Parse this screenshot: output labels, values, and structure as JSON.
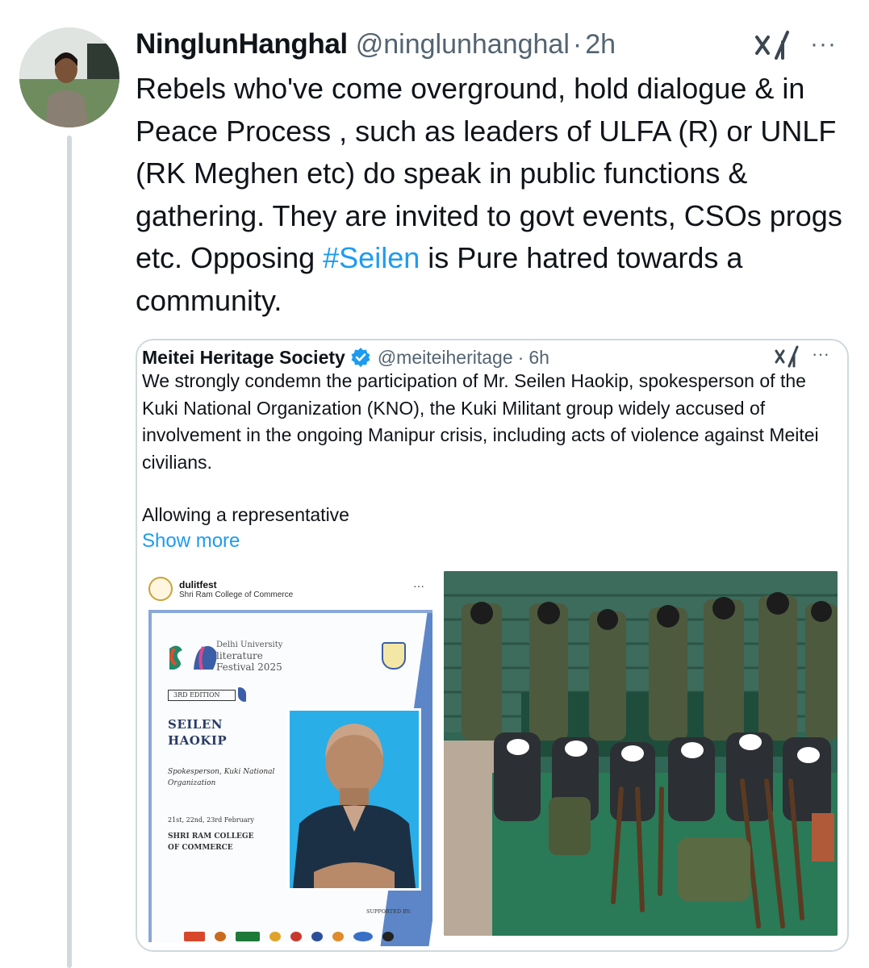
{
  "author": {
    "name": "NinglunHanghal",
    "handle": "@ninglunhanghal",
    "separator": "·",
    "time": "2h",
    "more": "···"
  },
  "tweet": {
    "text_before": "Rebels who've come overground, hold dialogue & in Peace Process , such as leaders of ULFA (R) or UNLF (RK Meghen etc) do speak in public functions & gathering. They are invited to govt events, CSOs progs etc. Opposing ",
    "hashtag": "#Seilen",
    "text_after": " is Pure hatred towards a community."
  },
  "quote": {
    "name": "Meitei Heritage Society",
    "handle": "@meiteiheritage",
    "separator": "·",
    "time": "6h",
    "more": "···",
    "text": "We strongly condemn the participation of Mr. Seilen Haokip, spokesperson of the Kuki National Organization (KNO), the Kuki Militant group widely accused of involvement in the ongoing Manipur crisis, including acts of violence against Meitei civilians.",
    "text2": "Allowing a representative",
    "show_more": "Show more"
  },
  "poster": {
    "account": "dulitfest",
    "subtitle": "Shri Ram College of Commerce",
    "more": "···",
    "fest_line1": "Delhi University",
    "fest_line2": "literature",
    "fest_line3": "Festival 2025",
    "edition": "3RD EDITION",
    "speaker_line1": "SEILEN",
    "speaker_line2": "HAOKIP",
    "role": "Spokesperson, Kuki National Organization",
    "dates": "21st, 22nd, 23rd February",
    "venue_line1": "SHRI RAM COLLEGE",
    "venue_line2": "OF COMMERCE",
    "supported_by": "SUPPORTED BY:"
  },
  "colors": {
    "link": "#1d9bf0",
    "secondary": "#536471",
    "border": "#cfd9de",
    "poster_accent": "#5d86c8"
  },
  "icons": {
    "xai": "xai-grok-icon",
    "verified": "verified-badge-icon",
    "more": "more-icon"
  }
}
